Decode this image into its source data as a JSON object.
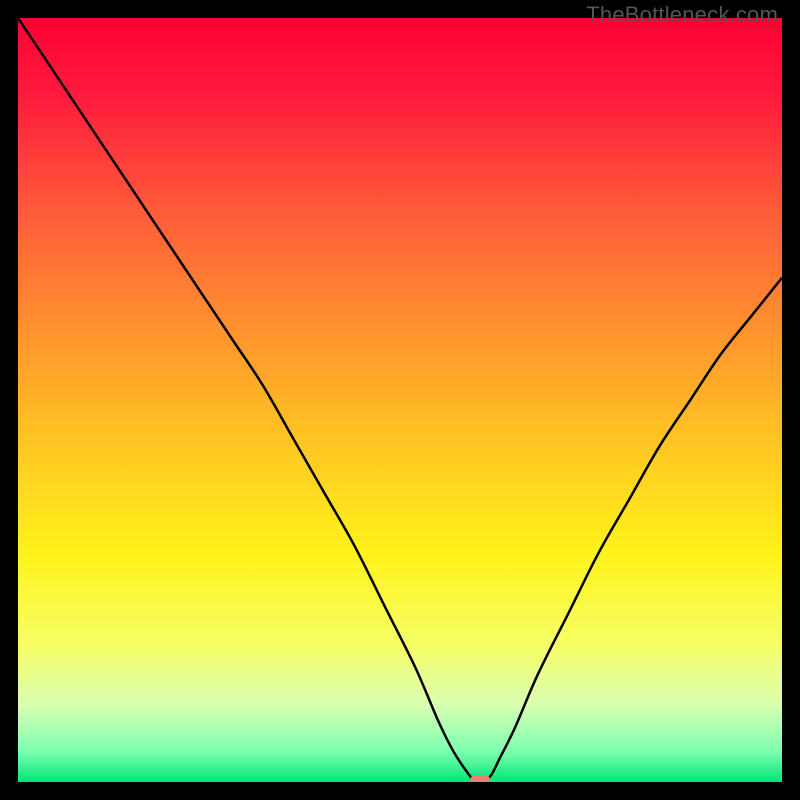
{
  "watermark": "TheBottleneck.com",
  "colors": {
    "gradient_stops": [
      {
        "offset": 0.0,
        "color": "#ff0033"
      },
      {
        "offset": 0.1,
        "color": "#ff1a3c"
      },
      {
        "offset": 0.25,
        "color": "#ff5a3a"
      },
      {
        "offset": 0.4,
        "color": "#ff8f2e"
      },
      {
        "offset": 0.55,
        "color": "#ffc423"
      },
      {
        "offset": 0.7,
        "color": "#fff21a"
      },
      {
        "offset": 0.82,
        "color": "#f6ff66"
      },
      {
        "offset": 0.9,
        "color": "#d9ffb3"
      },
      {
        "offset": 0.96,
        "color": "#7dffb0"
      },
      {
        "offset": 1.0,
        "color": "#00e676"
      }
    ],
    "curve": "#000000",
    "marker_fill": "#e98076",
    "frame_bg": "#000000"
  },
  "chart_data": {
    "type": "line",
    "title": "",
    "xlabel": "",
    "ylabel": "",
    "xlim": [
      0,
      100
    ],
    "ylim": [
      0,
      100
    ],
    "series": [
      {
        "name": "bottleneck-curve",
        "x": [
          0,
          4,
          8,
          12,
          16,
          20,
          24,
          28,
          32,
          36,
          40,
          44,
          48,
          52,
          55,
          57,
          59,
          60,
          61,
          62,
          63,
          65,
          68,
          72,
          76,
          80,
          84,
          88,
          92,
          96,
          100
        ],
        "y": [
          100,
          94,
          88,
          82,
          76,
          70,
          64,
          58,
          52,
          45,
          38,
          31,
          23,
          15,
          8,
          4,
          1,
          0,
          0,
          1,
          3,
          7,
          14,
          22,
          30,
          37,
          44,
          50,
          56,
          61,
          66
        ]
      }
    ],
    "marker": {
      "x": 60.5,
      "y": 0
    }
  }
}
